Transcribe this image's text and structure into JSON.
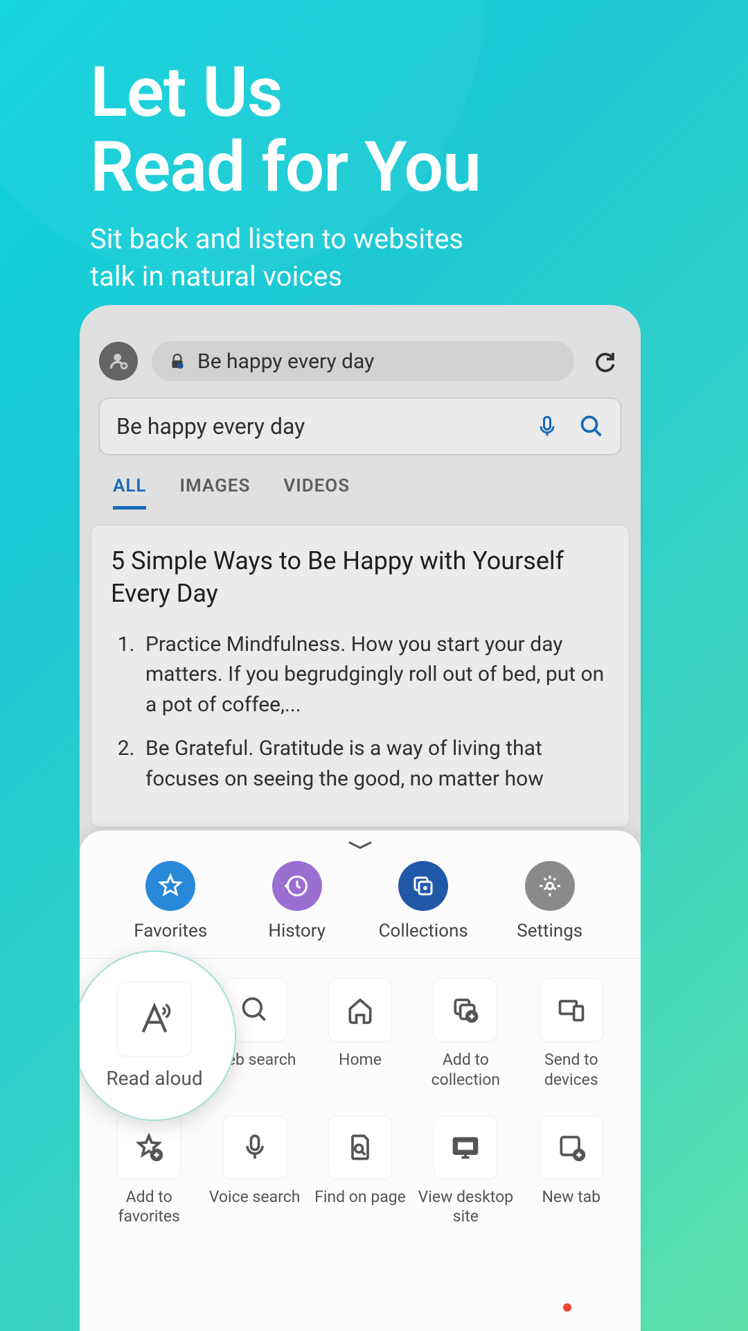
{
  "promo": {
    "title_line1": "Let Us",
    "title_line2": "Read for You",
    "subtitle_line1": "Sit back and listen to websites",
    "subtitle_line2": "talk in natural voices"
  },
  "browser": {
    "address_text": "Be happy every day",
    "search_text": "Be happy every day"
  },
  "tabs": {
    "all": "ALL",
    "images": "IMAGES",
    "videos": "VIDEOS"
  },
  "article": {
    "title": " 5 Simple Ways to Be Happy with Yourself Every Day",
    "item1": "Practice Mindfulness. How you start your day matters. If you begrudgingly roll out of bed, put on a pot of coffee,...",
    "item2": "Be Grateful. Gratitude is a way of living that focuses on seeing the good, no matter how"
  },
  "sheet_primary": {
    "favorites": "Favorites",
    "history": "History",
    "collections": "Collections",
    "settings": "Settings"
  },
  "sheet_actions": {
    "read_aloud": "Read aloud",
    "web_search": "Web search",
    "home": "Home",
    "add_to_collection": "Add to collection",
    "send_to_devices": "Send to devices",
    "add_to_favorites": "Add to favorites",
    "voice_search": "Voice search",
    "find_on_page": "Find on page",
    "view_desktop_site": "View desktop site",
    "new_tab": "New tab"
  }
}
